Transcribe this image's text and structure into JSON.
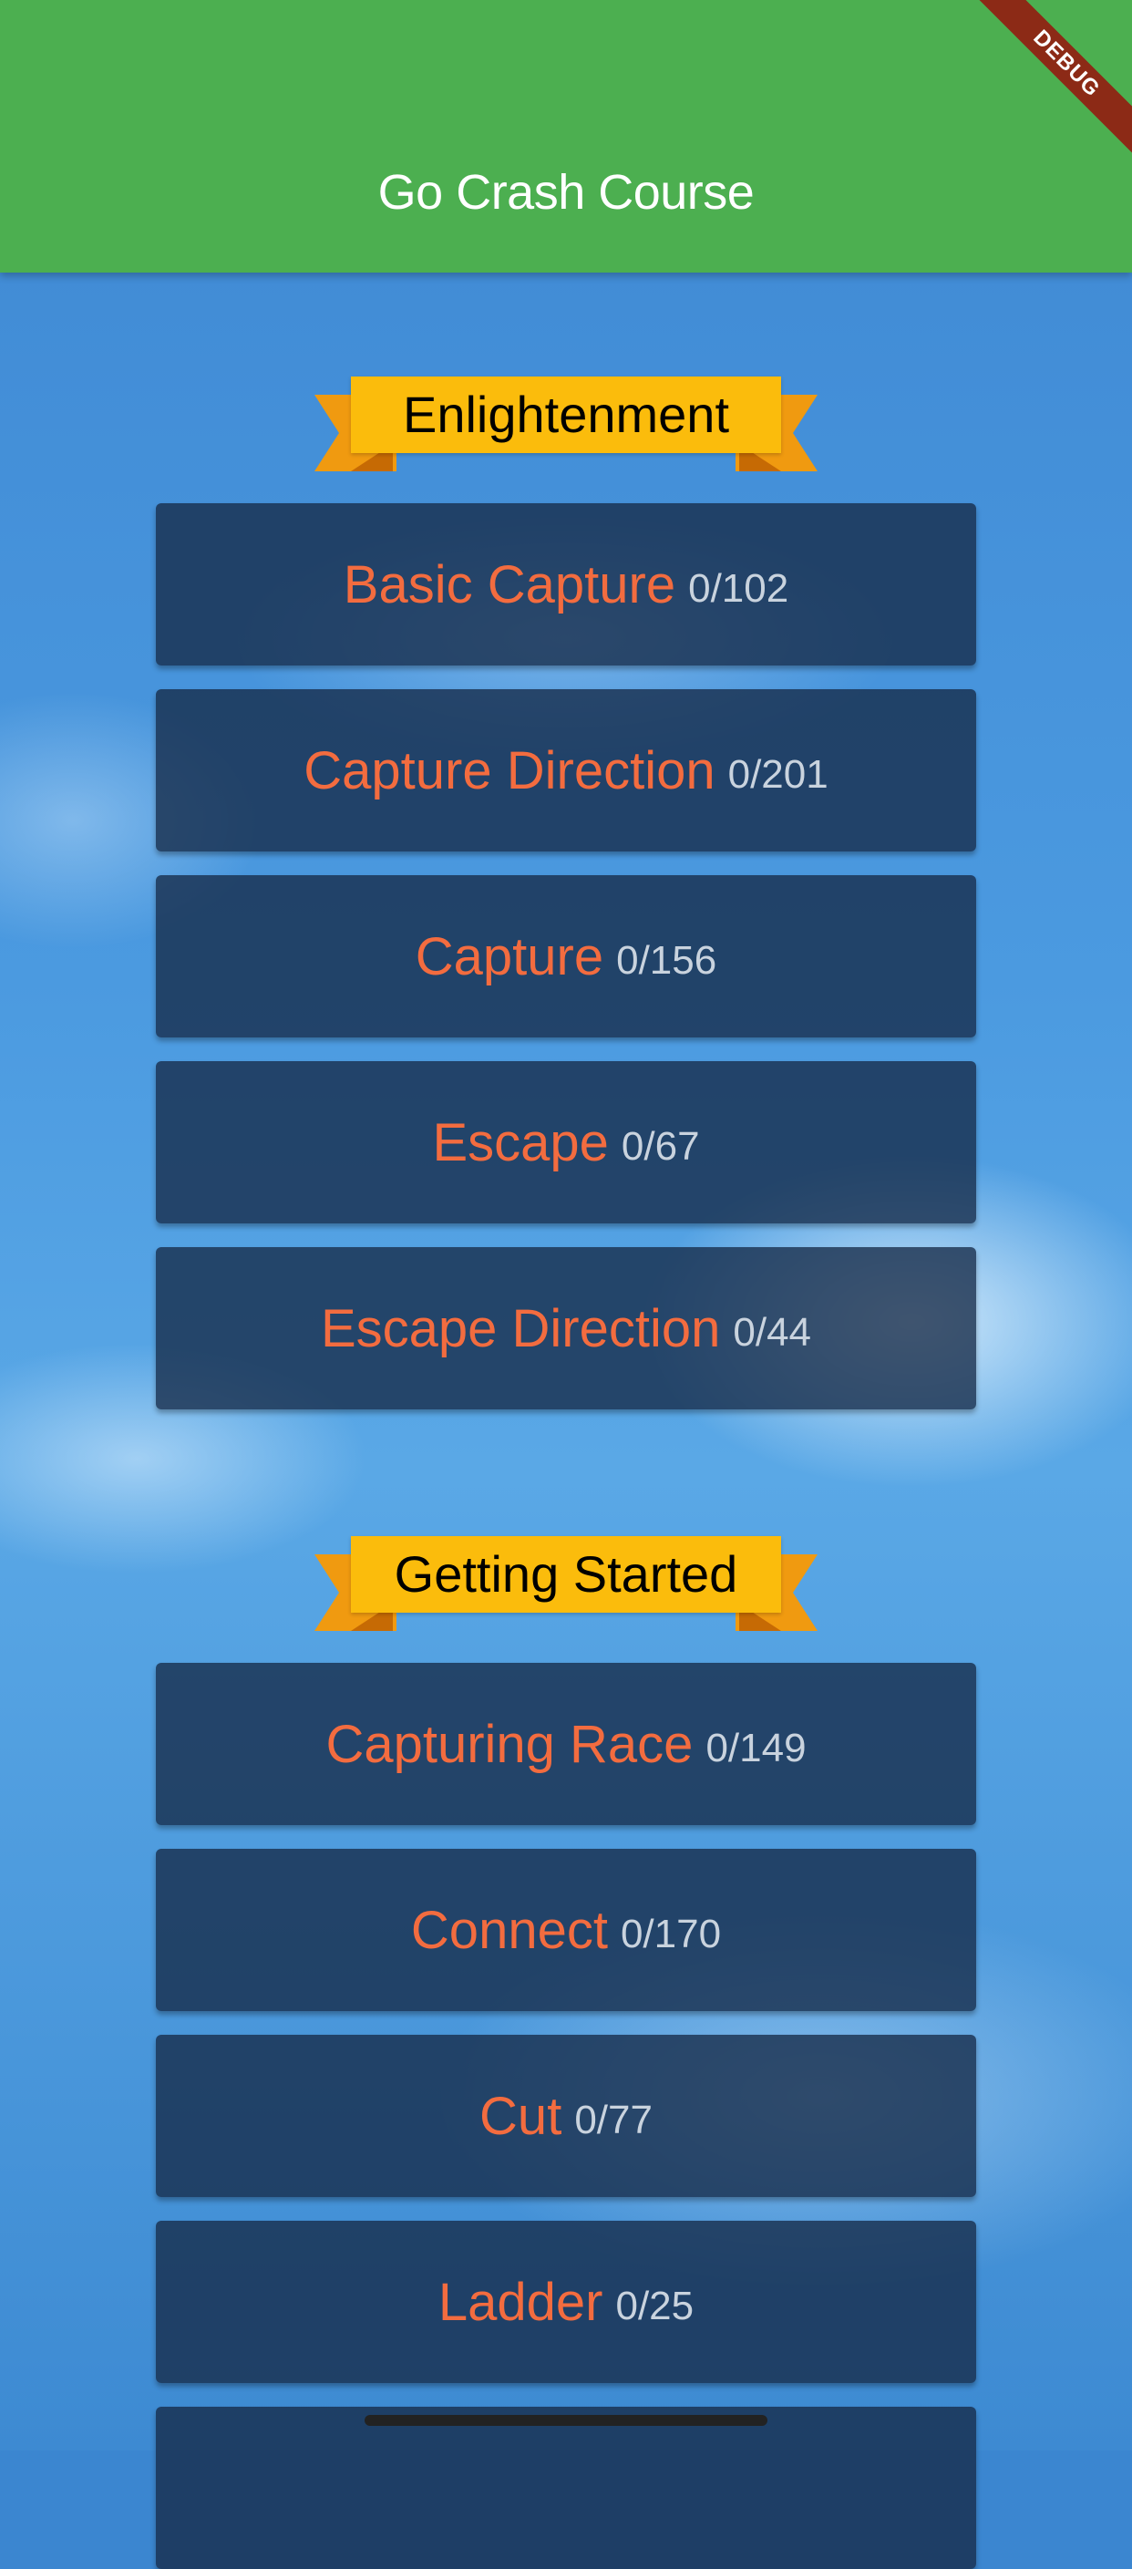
{
  "app": {
    "title": "Go Crash Course",
    "debug_label": "DEBUG"
  },
  "sections": [
    {
      "title": "Enlightenment",
      "items": [
        {
          "name": "Basic Capture",
          "progress": "0/102"
        },
        {
          "name": "Capture Direction",
          "progress": "0/201"
        },
        {
          "name": "Capture",
          "progress": "0/156"
        },
        {
          "name": "Escape",
          "progress": "0/67"
        },
        {
          "name": "Escape Direction",
          "progress": "0/44"
        }
      ]
    },
    {
      "title": "Getting Started",
      "items": [
        {
          "name": "Capturing Race",
          "progress": "0/149"
        },
        {
          "name": "Connect",
          "progress": "0/170"
        },
        {
          "name": "Cut",
          "progress": "0/77"
        },
        {
          "name": "Ladder",
          "progress": "0/25"
        }
      ]
    }
  ],
  "colors": {
    "appbar": "#4caf50",
    "banner": "#fbbc0c",
    "item_title": "#f36c3f",
    "item_background": "#162a48"
  }
}
